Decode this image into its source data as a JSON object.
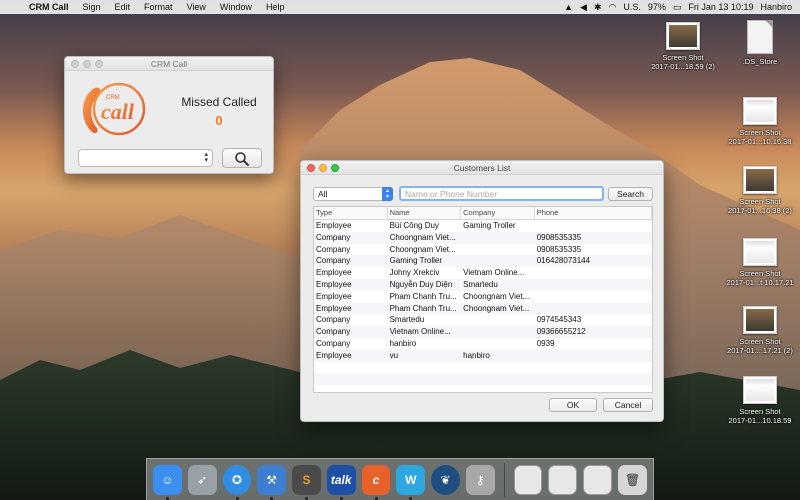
{
  "menubar": {
    "app_name": "CRM Call",
    "menus": [
      "Sign",
      "Edit",
      "Format",
      "View",
      "Window",
      "Help"
    ],
    "status": {
      "input_source": "U.S.",
      "battery": "97%",
      "clock": "Fri Jan 13  10:19",
      "user": "Hanbiro"
    }
  },
  "desktop_icons": [
    {
      "name": "Screen Shot",
      "sub": "2017-01...18.59 (2)",
      "kind": "screenshot"
    },
    {
      "name": ".DS_Store",
      "sub": "",
      "kind": "document"
    },
    {
      "name": "Screen Shot",
      "sub": "2017-01...10.16.38",
      "kind": "screenshot-ui"
    },
    {
      "name": "Screen Shot",
      "sub": "2017-01...16.38 (2)",
      "kind": "screenshot"
    },
    {
      "name": "Screen Shot",
      "sub": "2017-01...t 10.17.21",
      "kind": "screenshot-ui"
    },
    {
      "name": "Screen Shot",
      "sub": "2017-01....17.21 (2)",
      "kind": "screenshot"
    },
    {
      "name": "Screen Shot",
      "sub": "2017-01...10.18.59",
      "kind": "screenshot-ui"
    }
  ],
  "crm_window": {
    "title": "CRM Call",
    "logo_text": "call",
    "logo_small": "CRM",
    "missed_label": "Missed Called",
    "missed_count": "0",
    "select_value": "",
    "search_icon": "magnifier-icon"
  },
  "customers_window": {
    "title": "Customers List",
    "filter_value": "All",
    "search_placeholder": "Name or Phone Number",
    "search_button": "Search",
    "columns": [
      "Type",
      "Name",
      "Company",
      "Phone"
    ],
    "rows": [
      [
        "Employee",
        "Bùi Công Duy",
        "Gaming Troller",
        ""
      ],
      [
        "Company",
        "Choongnam Viet...",
        "",
        "0908535335"
      ],
      [
        "Company",
        "Choongnam Viet...",
        "",
        "0908535335"
      ],
      [
        "Company",
        "Gaming Troller",
        "",
        "016428073144"
      ],
      [
        "Employee",
        "Johny Xrekciv",
        "Vietnam Online...",
        ""
      ],
      [
        "Employee",
        "Nguyễn Duy Diện",
        "Smartedu",
        ""
      ],
      [
        "Employee",
        "Pham Chanh Tru...",
        "Choongnam Viet...",
        ""
      ],
      [
        "Employee",
        "Pham Chanh Tru...",
        "Choongnam Viet...",
        ""
      ],
      [
        "Company",
        "Smartedu",
        "",
        "0974545343"
      ],
      [
        "Company",
        "Vietnam Online...",
        "",
        "09366655212"
      ],
      [
        "Company",
        "hanbiro",
        "",
        "0939"
      ],
      [
        "Employee",
        "vu",
        "hanbiro",
        ""
      ]
    ],
    "ok_button": "OK",
    "cancel_button": "Cancel"
  },
  "dock": {
    "apps": [
      {
        "name": "finder-icon",
        "color": "#3b8ff0",
        "glyph": "☺"
      },
      {
        "name": "launchpad-icon",
        "color": "#9aa0a8",
        "glyph": "➶"
      },
      {
        "name": "safari-icon",
        "color": "#2f8de4",
        "glyph": "✪"
      },
      {
        "name": "xcode-icon",
        "color": "#3c7fd1",
        "glyph": "⚒"
      },
      {
        "name": "sublime-icon",
        "color": "#4a4a4a",
        "glyph": "S"
      },
      {
        "name": "talk-icon",
        "color": "#1f4fa3",
        "glyph": "talk"
      },
      {
        "name": "crm-call-icon",
        "color": "#e8602a",
        "glyph": "c"
      },
      {
        "name": "wordpress-icon",
        "color": "#2ca7e0",
        "glyph": "W"
      },
      {
        "name": "sourcetree-icon",
        "color": "#1e4f80",
        "glyph": "❦"
      },
      {
        "name": "keychain-icon",
        "color": "#a8a8a8",
        "glyph": "⚷"
      }
    ],
    "docs": [
      {
        "name": "stack-screenshot-icon"
      },
      {
        "name": "stack-screenshot-icon"
      },
      {
        "name": "stack-screenshot-icon"
      },
      {
        "name": "trash-icon"
      }
    ]
  }
}
